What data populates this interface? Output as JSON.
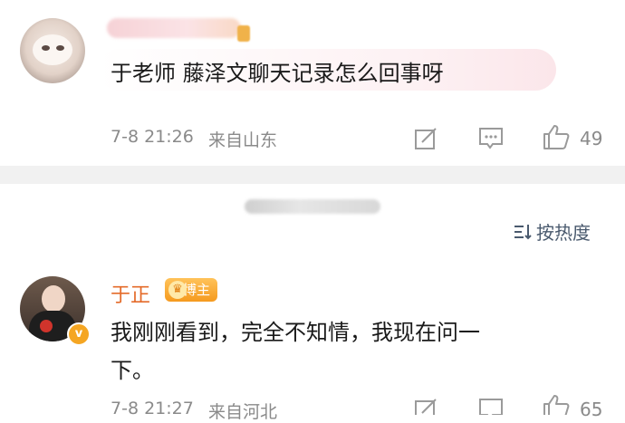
{
  "comment1": {
    "text": "于老师 藤泽文聊天记录怎么回事呀",
    "time": "7-8 21:26",
    "location": "来自山东",
    "likes": "49"
  },
  "sort": {
    "label": "按热度",
    "icon": "sort-icon"
  },
  "comment2": {
    "username": "于正",
    "tag": "博主",
    "text_line1": "我刚刚看到，完全不知情，我现在问一",
    "text_line2": "下。",
    "time": "7-8 21:27",
    "location": "来自河北",
    "likes": "65",
    "verify": "v"
  },
  "colors": {
    "username": "#e46b2a",
    "tag": "#f59a1e",
    "meta": "#8a8a8a"
  }
}
